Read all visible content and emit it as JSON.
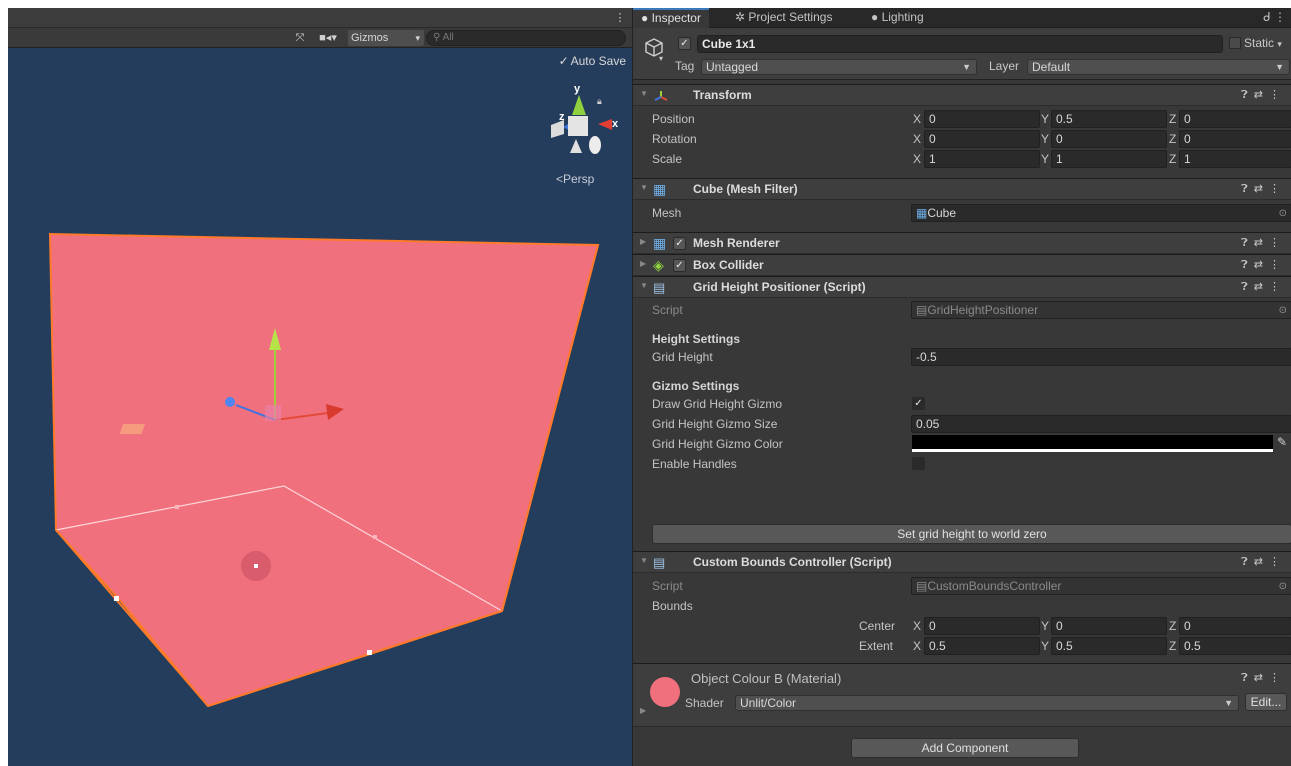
{
  "scene": {
    "gizmos_label": "Gizmos",
    "search_placeholder": "All",
    "auto_save_label": "Auto Save",
    "auto_save_checked": true,
    "persp_label": "<Persp",
    "axis_labels": {
      "x": "x",
      "y": "y",
      "z": "z"
    },
    "icons": [
      "tools-icon",
      "camera-icon",
      "search-icon",
      "lock-icon",
      "more-icon"
    ],
    "colors": {
      "background": "#253d5c",
      "plane_fill": "#f0707e",
      "outline": "#ff7a2b"
    }
  },
  "inspector": {
    "tabs": [
      {
        "label": "Inspector",
        "icon": "info-icon",
        "active": true
      },
      {
        "label": "Project Settings",
        "icon": "gear-icon",
        "active": false
      },
      {
        "label": "Lighting",
        "icon": "bulb-icon",
        "active": false
      }
    ],
    "object": {
      "active": true,
      "name": "Cube 1x1",
      "static_label": "Static",
      "tag_label": "Tag",
      "tag_value": "Untagged",
      "layer_label": "Layer",
      "layer_value": "Default"
    },
    "transform": {
      "title": "Transform",
      "rows": [
        {
          "label": "Position",
          "x": "0",
          "y": "0.5",
          "z": "0"
        },
        {
          "label": "Rotation",
          "x": "0",
          "y": "0",
          "z": "0"
        },
        {
          "label": "Scale",
          "x": "1",
          "y": "1",
          "z": "1"
        }
      ]
    },
    "mesh_filter": {
      "title": "Cube (Mesh Filter)",
      "mesh_label": "Mesh",
      "mesh_value": "Cube"
    },
    "mesh_renderer": {
      "title": "Mesh Renderer",
      "enabled": true
    },
    "box_collider": {
      "title": "Box Collider",
      "enabled": true
    },
    "grid_height_positioner": {
      "title": "Grid Height Positioner (Script)",
      "script_label": "Script",
      "script_value": "GridHeightPositioner",
      "height_section": "Height Settings",
      "grid_height_label": "Grid Height",
      "grid_height_value": "-0.5",
      "gizmo_section": "Gizmo Settings",
      "draw_gizmo_label": "Draw Grid Height Gizmo",
      "draw_gizmo_checked": true,
      "gizmo_size_label": "Grid Height Gizmo Size",
      "gizmo_size_value": "0.05",
      "gizmo_color_label": "Grid Height Gizmo Color",
      "gizmo_color": "#000000",
      "enable_handles_label": "Enable Handles",
      "enable_handles_checked": false,
      "button_label": "Set grid height to world zero"
    },
    "custom_bounds_controller": {
      "title": "Custom Bounds Controller (Script)",
      "script_label": "Script",
      "script_value": "CustomBoundsController",
      "bounds_label": "Bounds",
      "center_label": "Center",
      "center": {
        "x": "0",
        "y": "0",
        "z": "0"
      },
      "extent_label": "Extent",
      "extent": {
        "x": "0.5",
        "y": "0.5",
        "z": "0.5"
      }
    },
    "material": {
      "title": "Object Colour B (Material)",
      "shader_label": "Shader",
      "shader_value": "Unlit/Color",
      "edit_label": "Edit...",
      "swatch_color": "#f0707e"
    },
    "add_component_label": "Add Component",
    "axis_letters": {
      "x": "X",
      "y": "Y",
      "z": "Z"
    }
  }
}
